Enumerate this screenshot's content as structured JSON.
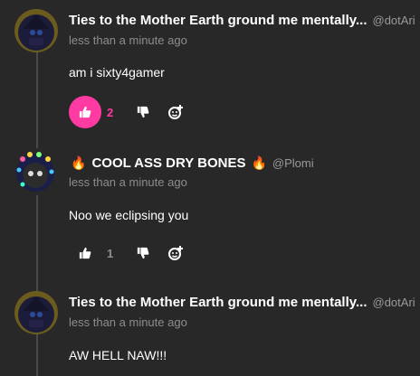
{
  "comments": [
    {
      "author": "Ties to the Mother Earth ground me mentally...",
      "handle": "@dotAri",
      "time": "less than a minute ago",
      "text": "am i sixty4gamer",
      "likes": "2",
      "liked": true
    },
    {
      "author": "COOL ASS DRY BONES",
      "handle": "@Plomi",
      "emoji_before": "🔥",
      "emoji_after": "🔥",
      "time": "less than a minute ago",
      "text": "Noo we eclipsing you",
      "likes": "1",
      "liked": false
    },
    {
      "author": "Ties to the Mother Earth ground me mentally...",
      "handle": "@dotAri",
      "time": "less than a minute ago",
      "text": "AW HELL NAW!!!"
    }
  ],
  "colors": {
    "background": "#282828",
    "accent_pink": "#ff3aa3",
    "muted_text": "#8d8d8d"
  },
  "icons": [
    "thumbs-up-icon",
    "thumbs-down-icon",
    "add-reaction-icon"
  ]
}
